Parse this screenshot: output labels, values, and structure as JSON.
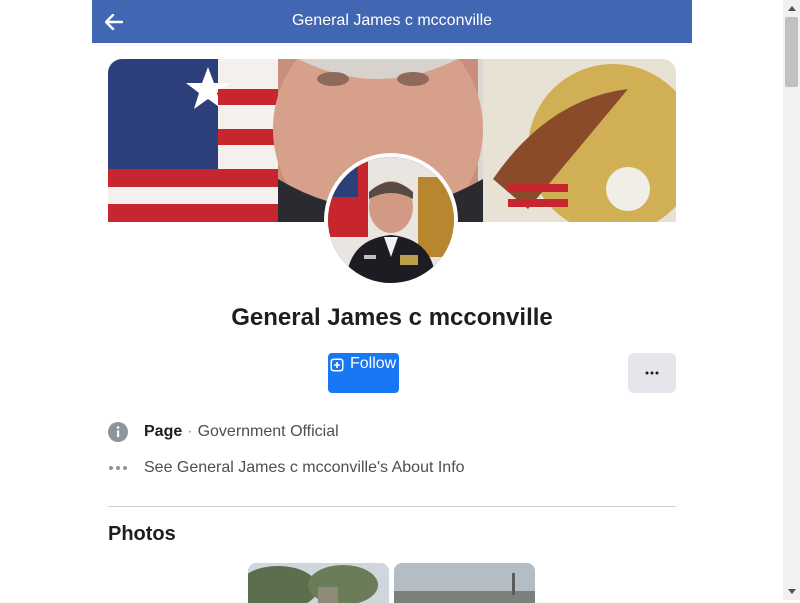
{
  "header": {
    "title": "General James c mcconville",
    "back_icon": "arrow-left-icon",
    "background": "#4267b2"
  },
  "profile": {
    "name": "General James c mcconville",
    "cover_alt": "cover-photo",
    "avatar_alt": "profile-photo"
  },
  "actions": {
    "follow_label": "Follow",
    "follow_icon": "follow-plus-icon",
    "follow_color": "#1877f2",
    "more_label": "···",
    "more_icon": "more-options-icon"
  },
  "info": {
    "type_label": "Page",
    "separator": "·",
    "category": "Government Official",
    "about_text": "See General James c mcconville's About Info",
    "info_icon": "info-circle-icon",
    "about_icon": "more-dots-icon"
  },
  "photos": {
    "title": "Photos"
  }
}
